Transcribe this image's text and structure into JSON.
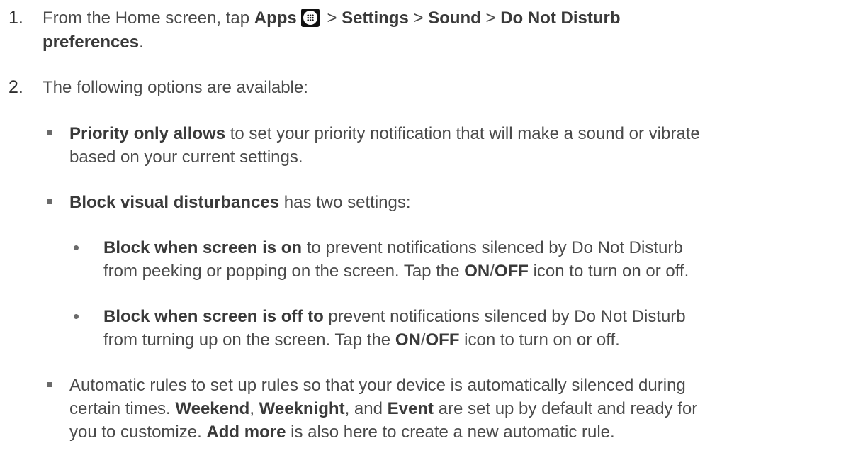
{
  "step1": {
    "number": "1.",
    "t1": "From the Home screen, tap ",
    "apps": "Apps",
    "apps_icon": "apps-grid-icon",
    "sep1": " > ",
    "settings": "Settings",
    "sep2": " > ",
    "sound": "Sound",
    "sep3": " > ",
    "dnd": "Do Not Disturb",
    "preferences": "preferences",
    "end": "."
  },
  "step2": {
    "number": "2.",
    "text": "The following options are available:"
  },
  "priority": {
    "bold": "Priority only allows",
    "line1": " to set your priority notification that will make a sound or vibrate",
    "line2": "based on your current settings."
  },
  "block_visual": {
    "bold": "Block visual disturbances",
    "text": " has two settings:"
  },
  "screen_on": {
    "bold": "Block when screen is on",
    "line1": " to prevent notifications silenced by Do Not Disturb",
    "line2": "from peeking or popping on the screen. Tap the ",
    "on": "ON",
    "slash": "/",
    "off": "OFF",
    "end": " icon to turn on or off."
  },
  "screen_off": {
    "bold": "Block when screen is off to",
    "line1": " prevent notifications silenced by Do Not Disturb",
    "line2": "from turning up on the screen. Tap the ",
    "on": "ON",
    "slash": "/",
    "off": "OFF",
    "end": " icon to turn on or off."
  },
  "auto_rules": {
    "line1": "Automatic rules to set up rules so that your device is automatically silenced during",
    "line2a": "certain times. ",
    "weekend": "Weekend",
    "comma1": ", ",
    "weeknight": "Weeknight",
    "and": ", and ",
    "event": "Event",
    "line2b": " are set up by default and ready for",
    "line3a": "you to customize. ",
    "add_more": "Add more",
    "line3b": " is also here to create a new automatic rule."
  }
}
